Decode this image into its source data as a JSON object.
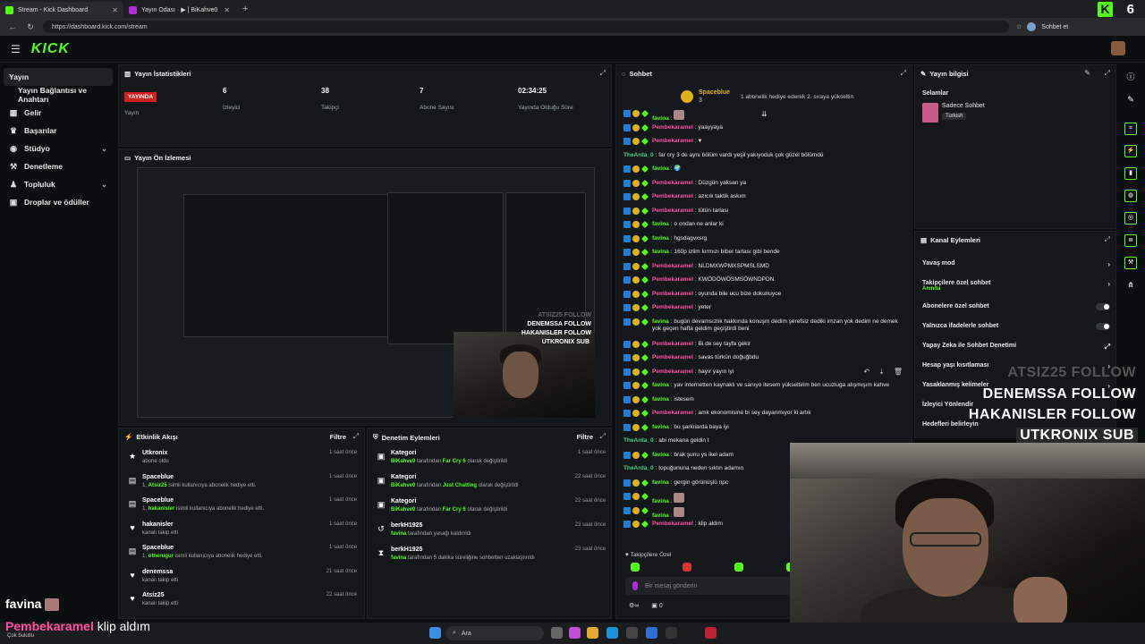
{
  "browser": {
    "tabs": [
      {
        "title": "Stream - Kick Dashboard"
      },
      {
        "title": "Yayın Odası · ▶ | BiKahve0"
      }
    ],
    "url": "https://dashboard.kick.com/stream",
    "sohbet_label": "Sohbet et",
    "brand_num": "6"
  },
  "header": {
    "logo": "KICK"
  },
  "sidebar": {
    "items": [
      {
        "label": "Yayın",
        "active": true
      },
      {
        "label": "Yayın Bağlantısı ve Anahtarı"
      },
      {
        "label": "Gelir"
      },
      {
        "label": "Başarılar"
      },
      {
        "label": "Stüdyo"
      },
      {
        "label": "Denetleme"
      },
      {
        "label": "Topluluk"
      },
      {
        "label": "Droplar ve ödüller"
      }
    ]
  },
  "stats": {
    "title": "Yayın İstatistikleri",
    "items": [
      {
        "value": "YAYINDA",
        "label": "Yayın"
      },
      {
        "value": "6",
        "label": "İzleyici"
      },
      {
        "value": "38",
        "label": "Takipçi"
      },
      {
        "value": "7",
        "label": "Abone Sayısı"
      },
      {
        "value": "02:34:25",
        "label": "Yayında Olduğu Süre"
      }
    ]
  },
  "preview": {
    "title": "Yayın Ön İzlemesi",
    "overlay": [
      "ATSIZ25  FOLLOW",
      "DENEMSSA  FOLLOW",
      "HAKANISLER  FOLLOW",
      "UTKRONIX  SUB"
    ]
  },
  "activity": {
    "title": "Etkinlik Akışı",
    "filter": "Filtre",
    "items": [
      {
        "name": "Utkronix",
        "pre": "",
        "hl": "",
        "post": "abone oldu",
        "time": "1 saat önce",
        "icon": "★"
      },
      {
        "name": "Spaceblue",
        "pre": "1, ",
        "hl": "Atsiz25",
        "post": " isimli kullanıcıya abonelik hediye etti.",
        "time": "1 saat önce",
        "icon": "▤"
      },
      {
        "name": "Spaceblue",
        "pre": "1, ",
        "hl": "hakanisler",
        "post": " isimli kullanıcıya abonelik hediye etti.",
        "time": "1 saat önce",
        "icon": "▤"
      },
      {
        "name": "hakanisler",
        "pre": "",
        "hl": "",
        "post": "kanalı takip etti",
        "time": "1 saat önce",
        "icon": "♥"
      },
      {
        "name": "Spaceblue",
        "pre": "1, ",
        "hl": "otherugur",
        "post": " isimli kullanıcıya abonelik hediye etti.",
        "time": "1 saat önce",
        "icon": "▤"
      },
      {
        "name": "denemssa",
        "pre": "",
        "hl": "",
        "post": "kanalı takip etti",
        "time": "21 saat önce",
        "icon": "♥"
      },
      {
        "name": "Atsiz25",
        "pre": "",
        "hl": "",
        "post": "kanalı takip etti",
        "time": "22 saat önce",
        "icon": "♥"
      }
    ]
  },
  "moderation": {
    "title": "Denetim Eylemleri",
    "filter": "Filtre",
    "items": [
      {
        "name": "Kategori",
        "hl1": "BiKahve0",
        "mid": " tarafından ",
        "hl2": "Far Cry 6",
        "post": " olarak değiştirildi",
        "time": "1 saat önce",
        "icon": "▣"
      },
      {
        "name": "Kategori",
        "hl1": "BiKahve0",
        "mid": " tarafından ",
        "hl2": "Just Chatting",
        "post": " olarak değiştirildi",
        "time": "22 saat önce",
        "icon": "▣"
      },
      {
        "name": "Kategori",
        "hl1": "BiKahve0",
        "mid": " tarafından ",
        "hl2": "Far Cry 6",
        "post": " olarak değiştirildi",
        "time": "22 saat önce",
        "icon": "▣"
      },
      {
        "name": "berkH1925",
        "hl1": "favina",
        "mid": " tarafından yasağı kaldırıldı",
        "hl2": "",
        "post": "",
        "time": "23 saat önce",
        "icon": "↺"
      },
      {
        "name": "berkH1925",
        "hl1": "favina",
        "mid": " tarafından 5 dakika süreliğine sohbetten uzaklaştırıldı",
        "hl2": "",
        "post": "",
        "time": "23 saat önce",
        "icon": "⧗"
      }
    ]
  },
  "chat": {
    "title": "Sohbet",
    "pinned_user": "Spaceblue",
    "pinned_count": "3",
    "pinned_text": "1 abonelik hediye ederek 2. sıraya yükseltin",
    "messages": [
      {
        "user": "favina",
        "color": "green",
        "text": ""
      },
      {
        "user": "Pembekaramel",
        "color": "pink",
        "text": "yaayyaya"
      },
      {
        "user": "Pembekaramel",
        "color": "pink",
        "text": "♥"
      },
      {
        "user": "TheArda_0",
        "color": "teal",
        "text": "far cry 3 de aynı bölüm vardı yeşil yakıyoduk çok güzel bölümdü",
        "nobadge": true
      },
      {
        "user": "favina",
        "color": "green",
        "text": "🌍"
      },
      {
        "user": "Pembekaramel",
        "color": "pink",
        "text": "Düzgün yaksan ya"
      },
      {
        "user": "Pembekaramel",
        "color": "pink",
        "text": "azıcık taktik askım"
      },
      {
        "user": "Pembekaramel",
        "color": "pink",
        "text": "tütün tarlası"
      },
      {
        "user": "favina",
        "color": "green",
        "text": "o ondan ne anlar ki"
      },
      {
        "user": "favina",
        "color": "green",
        "text": "hgsdagvxsrg"
      },
      {
        "user": "favina",
        "color": "green",
        "text": "160p izlim kırmızı biber tarlası gibi bende"
      },
      {
        "user": "Pembekaramel",
        "color": "pink",
        "text": "NLDMXWPMXSPMSLSMD"
      },
      {
        "user": "Pembekaramel",
        "color": "pink",
        "text": "KWÖDÖWÖSMSÖWNDPDN"
      },
      {
        "user": "Pembekaramel",
        "color": "pink",
        "text": "oyunda bile ucu bize dokunuyoe"
      },
      {
        "user": "Pembekaramel",
        "color": "pink",
        "text": "yeter"
      },
      {
        "user": "favina",
        "color": "green",
        "text": "bugün devamsızlık hakkında konuşm dedim şerefsiz dediki imzan yok dedim ne demek yok geçen hafta geldim geçiştirdi beni",
        "tall": true
      },
      {
        "user": "Pembekaramel",
        "color": "pink",
        "text": "Bi de sey tayfa gekir"
      },
      {
        "user": "Pembekaramel",
        "color": "pink",
        "text": "savas türkün doğuğbdu"
      },
      {
        "user": "Pembekaramel",
        "color": "pink",
        "text": "hayır yayın iyi"
      },
      {
        "user": "favina",
        "color": "green",
        "text": "yav internetten kaynaklı ve sanıyo itesem yükseltirim ben ucuzluga alışmışım kahve"
      },
      {
        "user": "favina",
        "color": "green",
        "text": "istesem"
      },
      {
        "user": "Pembekaramel",
        "color": "pink",
        "text": "amk ekonomisine bi sey dayanmıyor ki artık"
      },
      {
        "user": "favina",
        "color": "green",
        "text": "bu şarkılarda baya iyi"
      },
      {
        "user": "TheArda_0",
        "color": "teal",
        "text": "abi mekana geldin t",
        "nobadge": true
      },
      {
        "user": "favina",
        "color": "green",
        "text": "brak şunu ys ikel adam"
      },
      {
        "user": "TheArda_0",
        "color": "teal",
        "text": "topuğununa neden sıktın adamın",
        "nobadge": true
      },
      {
        "user": "favina",
        "color": "green",
        "text": "gergin görünüşlü npc"
      },
      {
        "user": "favina",
        "color": "green",
        "text": ""
      },
      {
        "user": "favina",
        "color": "green",
        "text": ""
      },
      {
        "user": "Pembekaramel",
        "color": "pink",
        "text": "klip aldım"
      }
    ],
    "followers_only": "Takipçilere Özel",
    "input_placeholder": "Bir mesaj gönderin",
    "points": "0"
  },
  "stream_info": {
    "title": "Yayın bilgisi",
    "stream_title": "Selamlar",
    "category": "Sadece Sohbet",
    "language": "Turkish"
  },
  "channel_actions": {
    "title": "Kanal Eylemleri",
    "items": [
      {
        "label": "Yavaş mod",
        "control": "arrow"
      },
      {
        "label": "Takipçilere özel sohbet",
        "sub": "Anında",
        "control": "arrow"
      },
      {
        "label": "Abonelere özel sohbet",
        "control": "toggle"
      },
      {
        "label": "Yalnızca ifadelerle sohbet",
        "control": "toggle"
      },
      {
        "label": "Yapay Zeka ile Sohbet Denetimi",
        "control": "ext"
      },
      {
        "label": "Hesap yaşı kısıtlaması",
        "control": "arrow"
      },
      {
        "label": "Yasaklanmış kelimeler",
        "control": "arrow"
      },
      {
        "label": "İzleyici Yönlendir",
        "control": "none"
      },
      {
        "label": "Hedefleri belirleyin",
        "control": "none"
      }
    ]
  },
  "overlay": {
    "lines": [
      {
        "text": "ATSIZ25  FOLLOW",
        "dim": true
      },
      {
        "text": "DENEMSSA  FOLLOW"
      },
      {
        "text": "HAKANISLER  FOLLOW"
      },
      {
        "text": "UTKRONIX  SUB",
        "boxed": true
      }
    ],
    "chat_user": "favina",
    "chat_line_user": "Pembekaramel",
    "chat_line_text": "klip aldım"
  },
  "taskbar": {
    "search": "Ara",
    "weather": "Çok bulutlu"
  },
  "colors": {
    "accent": "#53fc18",
    "live": "#d11e1e",
    "pink": "#ff4fa3"
  }
}
